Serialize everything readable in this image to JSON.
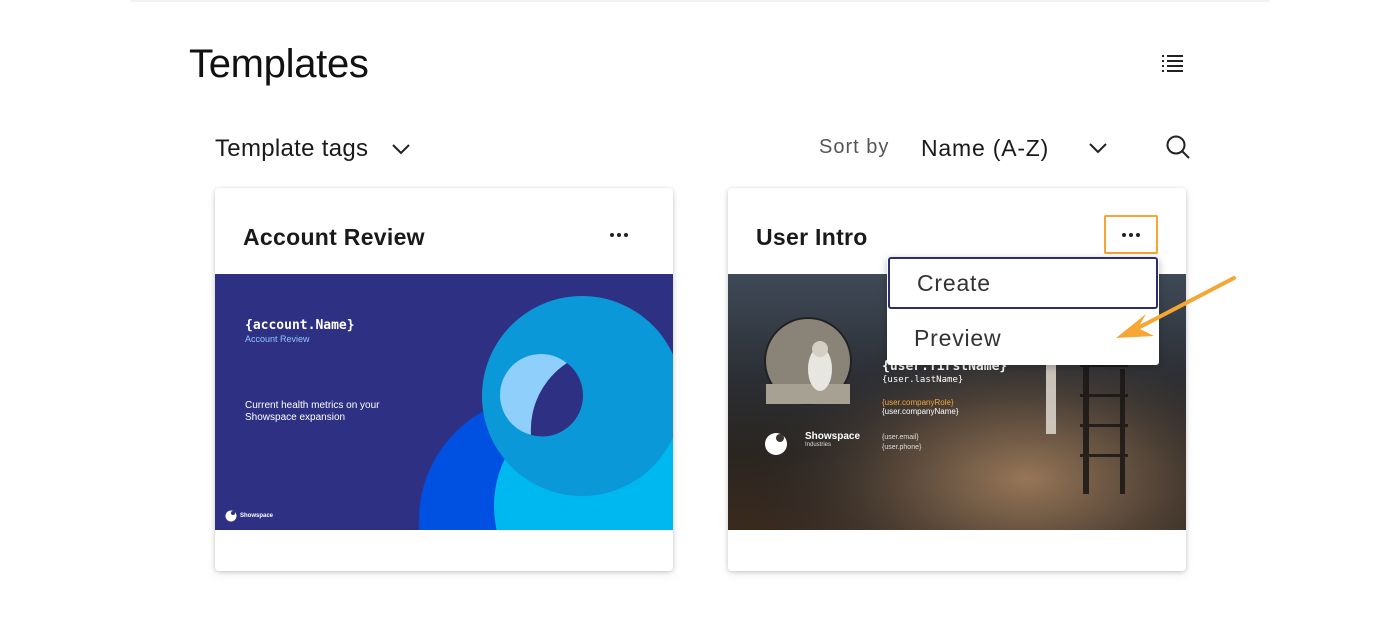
{
  "page": {
    "title": "Templates"
  },
  "filters": {
    "tags_label": "Template tags",
    "sort_label": "Sort by",
    "sort_value": "Name (A-Z)"
  },
  "cards": [
    {
      "title": "Account Review",
      "thumbnail": {
        "heading": "{account.Name}",
        "subheading": "Account Review",
        "description": "Current health metrics on your Showspace expansion",
        "brand": "Showspace"
      }
    },
    {
      "title": "User Intro",
      "thumbnail": {
        "first_name": "{user.firstName}",
        "last_name": "{user.lastName}",
        "company_role": "{user.companyRole}",
        "company_name": "{user.companyName}",
        "email": "{user.email}",
        "phone": "{user.phone}",
        "brand": "Showspace",
        "brand_sub": "Industries"
      }
    }
  ],
  "menu": {
    "create": "Create",
    "preview": "Preview"
  },
  "colors": {
    "highlight": "#f5a633",
    "focus_border": "#2e2d72",
    "account_bg": "#2e3183"
  },
  "icons": {
    "list_view": "list-view-icon",
    "chevron": "chevron-down-icon",
    "search": "search-icon",
    "more": "more-horizontal-icon"
  }
}
